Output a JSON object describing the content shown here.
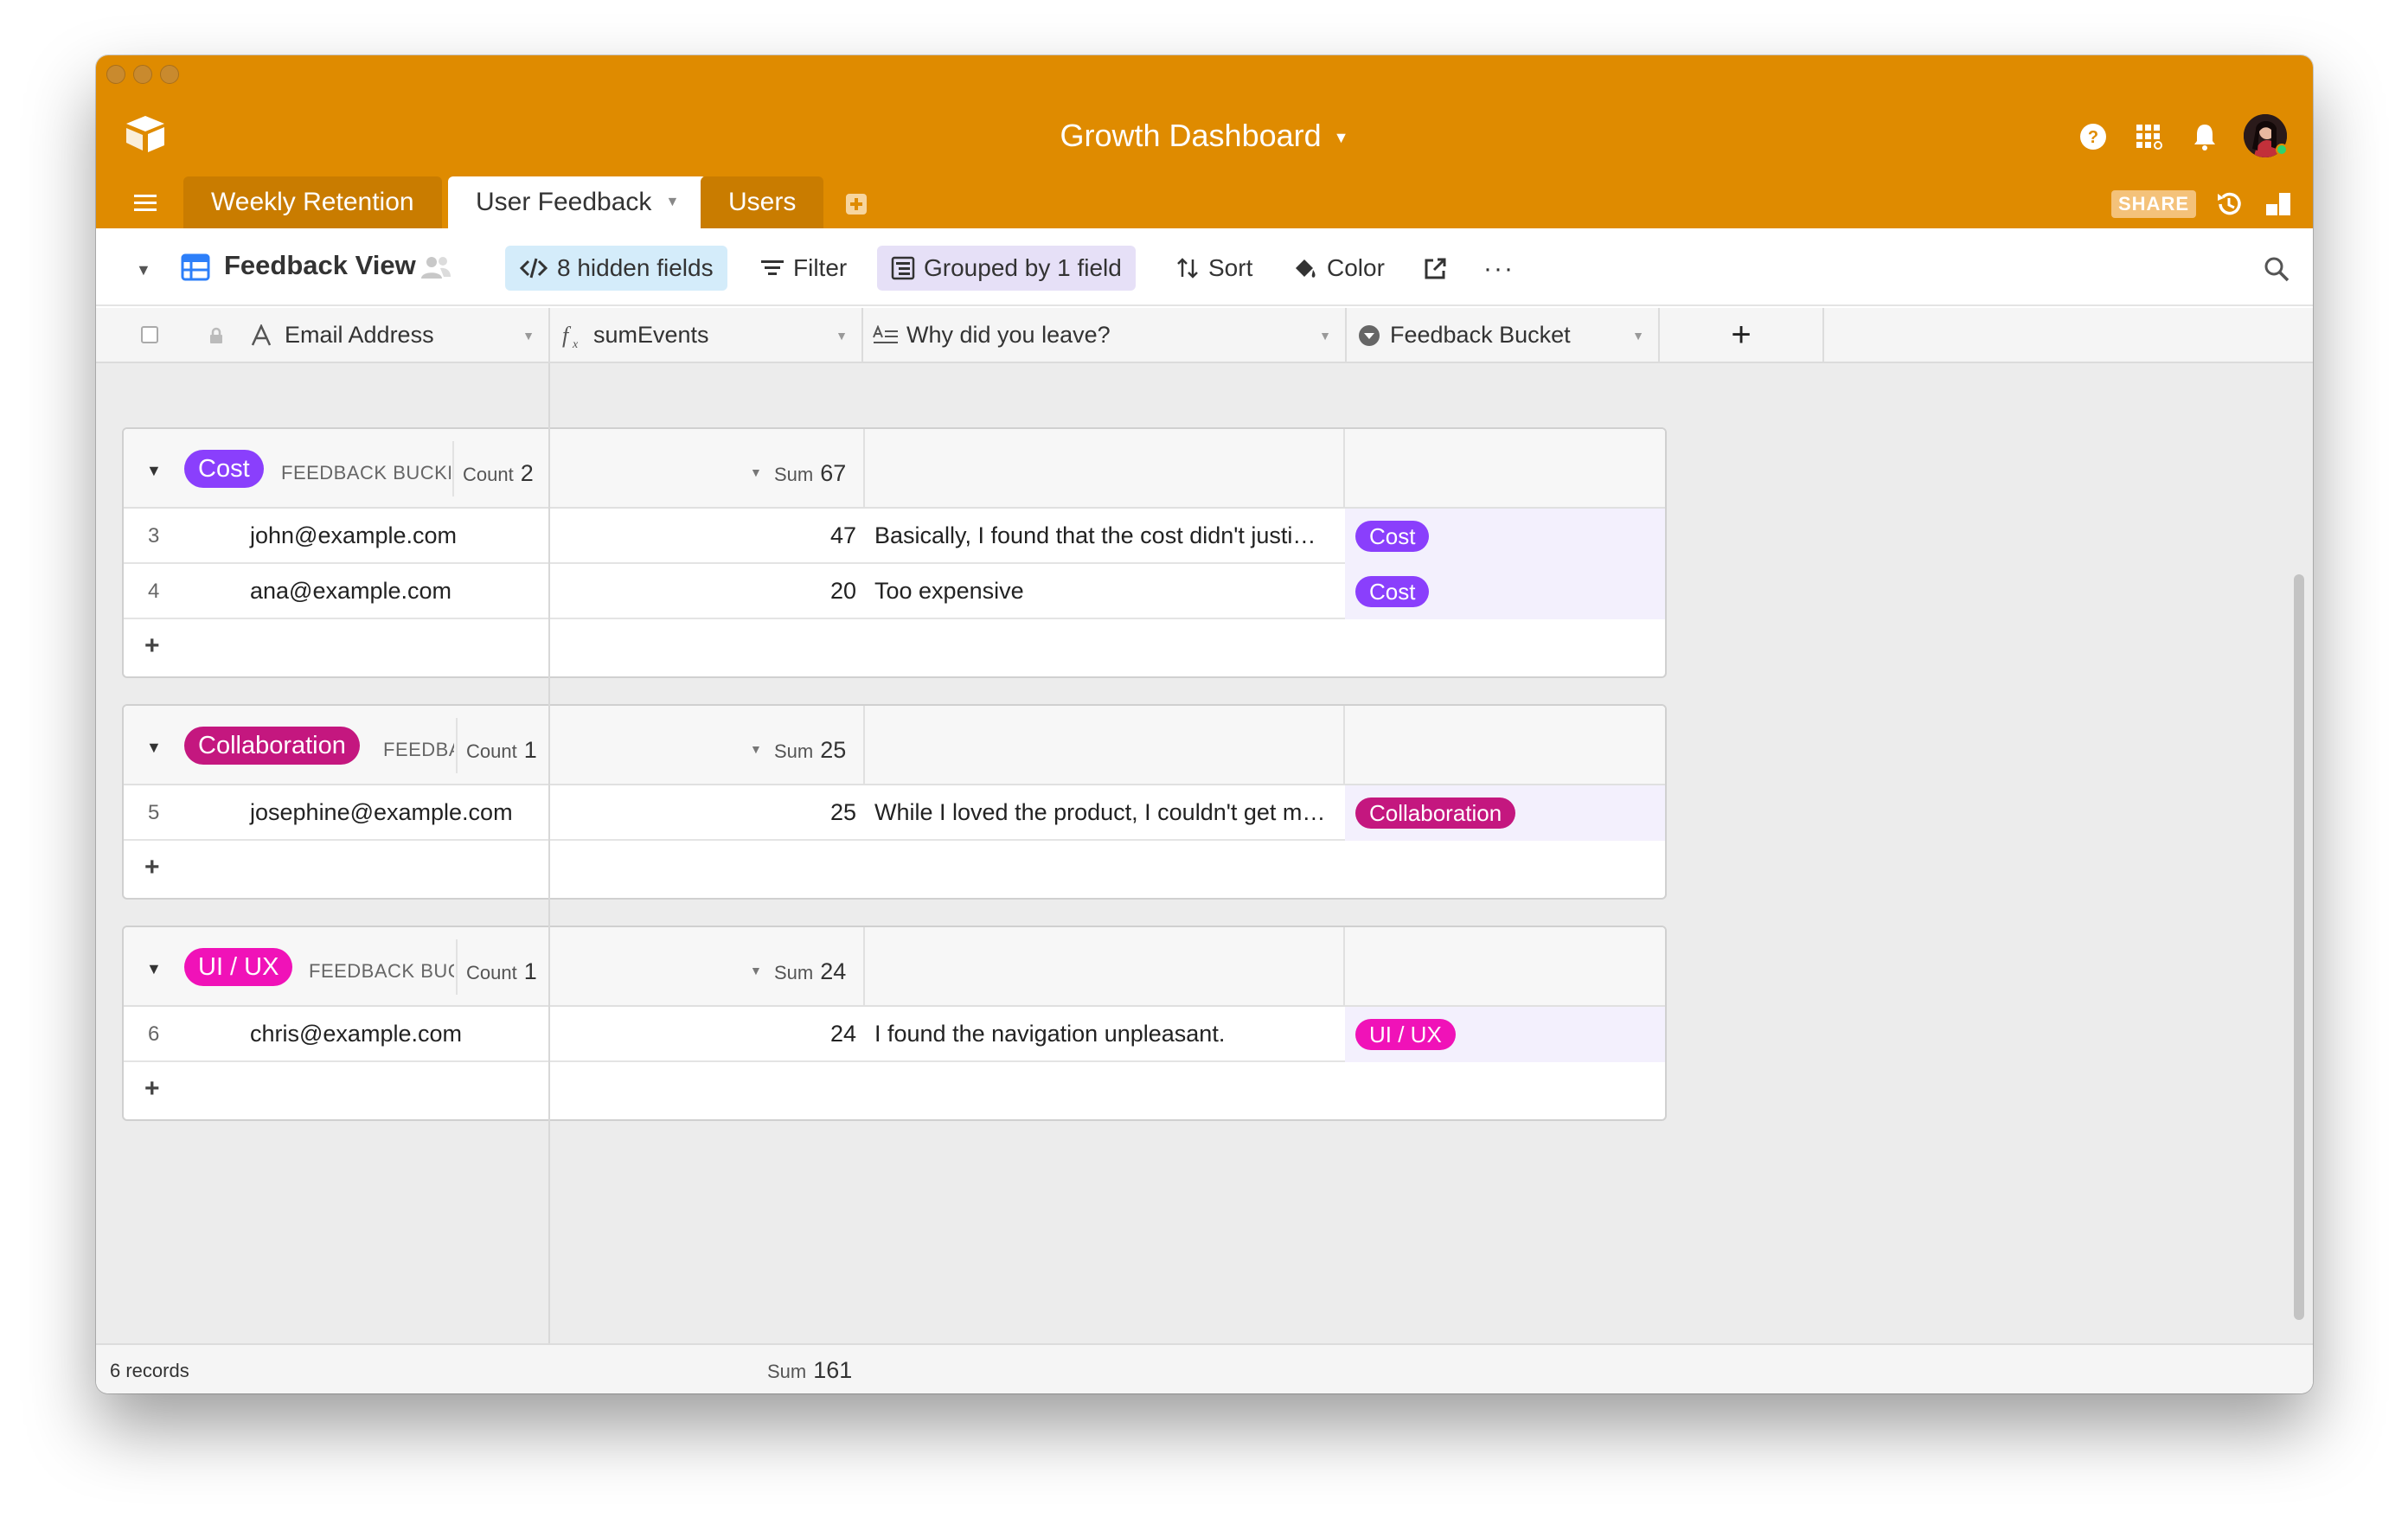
{
  "header": {
    "base_title": "Growth Dashboard",
    "tabs": [
      {
        "label": "Weekly Retention"
      },
      {
        "label": "User Feedback"
      },
      {
        "label": "Users"
      }
    ],
    "share_label": "SHARE"
  },
  "toolbar": {
    "view_name": "Feedback View",
    "hidden_fields": "8 hidden fields",
    "filter": "Filter",
    "grouped": "Grouped by 1 field",
    "sort": "Sort",
    "color": "Color"
  },
  "columns": [
    {
      "label": "Email Address"
    },
    {
      "label": "sumEvents"
    },
    {
      "label": "Why did you leave?"
    },
    {
      "label": "Feedback Bucket"
    }
  ],
  "groups": [
    {
      "name": "Cost",
      "color": "#8a3ffc",
      "field_label": "FEEDBACK BUCKE",
      "count_label": "Count",
      "count": "2",
      "sum_label": "Sum",
      "sum": "67",
      "rows": [
        {
          "num": "3",
          "email": "john@example.com",
          "sum": "47",
          "why": "Basically, I found that the cost didn't justi…",
          "bucket": "Cost"
        },
        {
          "num": "4",
          "email": "ana@example.com",
          "sum": "20",
          "why": "Too expensive",
          "bucket": "Cost"
        }
      ]
    },
    {
      "name": "Collaboration",
      "color": "#c4177f",
      "field_label": "FEEDBA",
      "count_label": "Count",
      "count": "1",
      "sum_label": "Sum",
      "sum": "25",
      "rows": [
        {
          "num": "5",
          "email": "josephine@example.com",
          "sum": "25",
          "why": "While I loved the product, I couldn't get m…",
          "bucket": "Collaboration"
        }
      ]
    },
    {
      "name": "UI / UX",
      "color": "#f012b8",
      "field_label": "FEEDBACK BUC",
      "count_label": "Count",
      "count": "1",
      "sum_label": "Sum",
      "sum": "24",
      "rows": [
        {
          "num": "6",
          "email": "chris@example.com",
          "sum": "24",
          "why": "I found the navigation unpleasant.",
          "bucket": "UI / UX"
        }
      ]
    }
  ],
  "footer": {
    "records": "6 records",
    "sum_label": "Sum",
    "sum": "161"
  },
  "colors": {
    "header": "#df8b00",
    "accent": "#2d7ff9"
  }
}
